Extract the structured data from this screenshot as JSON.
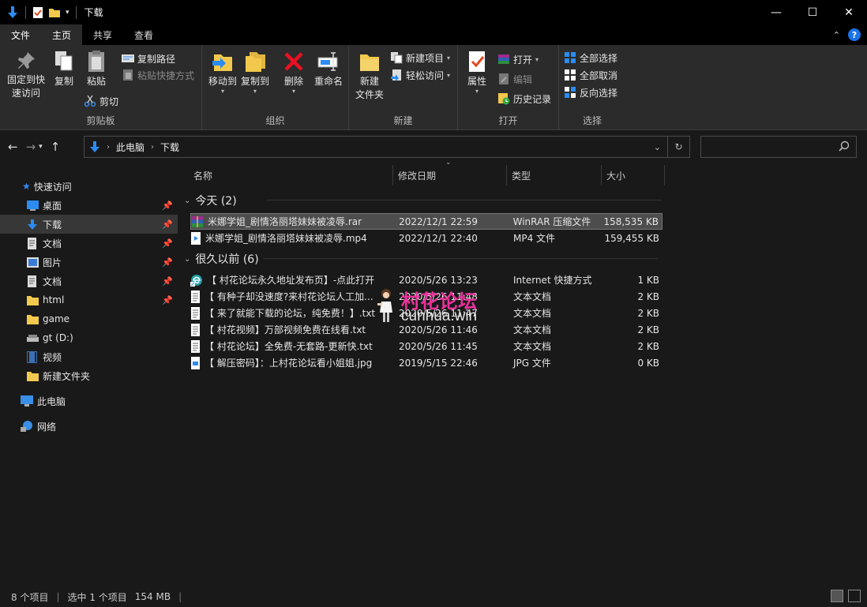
{
  "window": {
    "title": "下载",
    "controls": {
      "minimize": "—",
      "maximize": "☐",
      "close": "✕"
    }
  },
  "ribbon_tabs": [
    {
      "label": "文件",
      "kind": "file"
    },
    {
      "label": "主页",
      "kind": "active"
    },
    {
      "label": "共享",
      "kind": "normal"
    },
    {
      "label": "查看",
      "kind": "normal"
    }
  ],
  "ribbon": {
    "clipboard": {
      "pin_label": "固定到快\n速访问",
      "copy": "复制",
      "paste": "粘贴",
      "copy_path": "复制路径",
      "paste_shortcut": "粘贴快捷方式",
      "cut": "剪切",
      "group_label": "剪贴板"
    },
    "organize": {
      "move_to": "移动到",
      "copy_to": "复制到",
      "delete": "删除",
      "rename": "重命名",
      "group_label": "组织"
    },
    "new": {
      "new_folder": "新建\n文件夹",
      "new_item": "新建项目",
      "easy_access": "轻松访问",
      "group_label": "新建"
    },
    "open": {
      "properties": "属性",
      "open": "打开",
      "edit": "编辑",
      "history": "历史记录",
      "group_label": "打开"
    },
    "select": {
      "select_all": "全部选择",
      "select_none": "全部取消",
      "invert": "反向选择",
      "group_label": "选择"
    }
  },
  "address": {
    "crumbs": [
      "此电脑",
      "下载"
    ]
  },
  "nav_pane": {
    "quick_access": "快速访问",
    "items": [
      {
        "label": "桌面",
        "icon": "desktop-icon",
        "pinned": true
      },
      {
        "label": "下载",
        "icon": "download-icon",
        "pinned": true,
        "selected": true
      },
      {
        "label": "文档",
        "icon": "document-icon",
        "pinned": true
      },
      {
        "label": "图片",
        "icon": "picture-icon",
        "pinned": true
      },
      {
        "label": "文档",
        "icon": "document-icon",
        "pinned": true
      },
      {
        "label": "html",
        "icon": "folder-icon",
        "pinned": true
      },
      {
        "label": "game",
        "icon": "folder-icon",
        "pinned": false
      },
      {
        "label": "gt (D:)",
        "icon": "drive-icon",
        "pinned": false
      },
      {
        "label": "视频",
        "icon": "video-icon",
        "pinned": false
      },
      {
        "label": "新建文件夹",
        "icon": "folder-icon",
        "pinned": false
      }
    ],
    "this_pc": "此电脑",
    "network": "网络"
  },
  "file_list": {
    "columns": [
      "名称",
      "修改日期",
      "类型",
      "大小"
    ],
    "groups": [
      {
        "label": "今天 (2)",
        "files": [
          {
            "name": "米娜学姐_剧情洛丽塔妹妹被凌辱.rar",
            "date": "2022/12/1 22:59",
            "type": "WinRAR 压缩文件",
            "size": "158,535 KB",
            "icon": "rar-icon",
            "selected": true
          },
          {
            "name": "米娜学姐_剧情洛丽塔妹妹被凌辱.mp4",
            "date": "2022/12/1 22:40",
            "type": "MP4 文件",
            "size": "159,455 KB",
            "icon": "video-file-icon",
            "selected": false
          }
        ]
      },
      {
        "label": "很久以前 (6)",
        "files": [
          {
            "name": "【 村花论坛永久地址发布页】-点此打开",
            "date": "2020/5/26 13:23",
            "type": "Internet 快捷方式",
            "size": "1 KB",
            "icon": "edge-link-icon",
            "selected": false
          },
          {
            "name": "【 有种子却没速度?来村花论坛人工加...",
            "date": "2020/5/26 11:48",
            "type": "文本文档",
            "size": "2 KB",
            "icon": "text-file-icon",
            "selected": false
          },
          {
            "name": "【 来了就能下载的论坛，纯免费！】.txt",
            "date": "2020/5/26 11:47",
            "type": "文本文档",
            "size": "2 KB",
            "icon": "text-file-icon",
            "selected": false
          },
          {
            "name": "【 村花视频】万部视频免费在线看.txt",
            "date": "2020/5/26 11:46",
            "type": "文本文档",
            "size": "2 KB",
            "icon": "text-file-icon",
            "selected": false
          },
          {
            "name": "【 村花论坛】全免费-无套路-更新快.txt",
            "date": "2020/5/26 11:45",
            "type": "文本文档",
            "size": "2 KB",
            "icon": "text-file-icon",
            "selected": false
          },
          {
            "name": "【 解压密码】：上村花论坛看小姐姐.jpg",
            "date": "2019/5/15 22:46",
            "type": "JPG 文件",
            "size": "0 KB",
            "icon": "image-file-icon",
            "selected": false
          }
        ]
      }
    ]
  },
  "status": {
    "count": "8 个项目",
    "selected": "选中 1 个项目",
    "size": "154 MB"
  },
  "watermark": {
    "line1": "村花论坛",
    "line2": "cunhua.win"
  },
  "colors": {
    "accent": "#1a73e8",
    "delete_red": "#e81123",
    "folder_yellow": "#f2c94c",
    "watermark_pink": "#e8329a"
  }
}
